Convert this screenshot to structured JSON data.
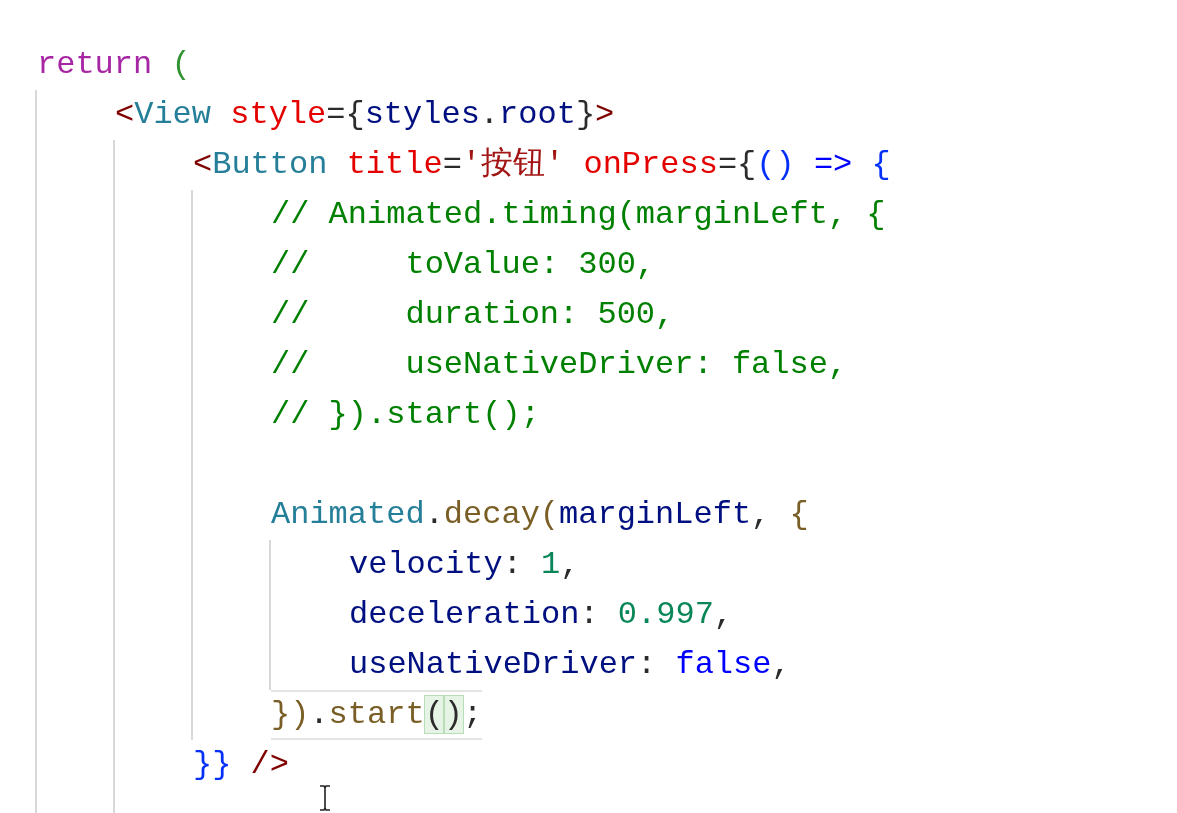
{
  "code_lines": [
    {
      "kind": "code",
      "current": false,
      "tokens": [
        {
          "text": "return ",
          "kind": "keyword"
        },
        {
          "text": "(",
          "kind": "bracket1"
        }
      ],
      "children": [
        {
          "kind": "code",
          "current": false,
          "tokens": [
            {
              "text": "<",
              "kind": "tag"
            },
            {
              "text": "View ",
              "kind": "type"
            },
            {
              "text": "style",
              "kind": "attr"
            },
            {
              "text": "=",
              "kind": "plain"
            },
            {
              "text": "{",
              "kind": "plain"
            },
            {
              "text": "styles",
              "kind": "var"
            },
            {
              "text": ".",
              "kind": "plain"
            },
            {
              "text": "root",
              "kind": "var"
            },
            {
              "text": "}",
              "kind": "plain"
            },
            {
              "text": ">",
              "kind": "tag"
            }
          ],
          "children": [
            {
              "kind": "code",
              "current": false,
              "tokens": [
                {
                  "text": "<",
                  "kind": "tag"
                },
                {
                  "text": "Button ",
                  "kind": "type"
                },
                {
                  "text": "title",
                  "kind": "attr"
                },
                {
                  "text": "=",
                  "kind": "plain"
                },
                {
                  "text": "'按钮' ",
                  "kind": "string"
                },
                {
                  "text": "onPress",
                  "kind": "attr"
                },
                {
                  "text": "=",
                  "kind": "plain"
                },
                {
                  "text": "{",
                  "kind": "plain"
                },
                {
                  "text": "() ",
                  "kind": "bracket3"
                },
                {
                  "text": "=> ",
                  "kind": "keyword2"
                },
                {
                  "text": "{",
                  "kind": "bracket3"
                }
              ],
              "children": [
                {
                  "kind": "code",
                  "current": false,
                  "tokens": [
                    {
                      "text": "// Animated.timing(marginLeft, {",
                      "kind": "comment"
                    }
                  ]
                },
                {
                  "kind": "code",
                  "current": false,
                  "tokens": [
                    {
                      "text": "//     toValue: 300,",
                      "kind": "comment"
                    }
                  ]
                },
                {
                  "kind": "code",
                  "current": false,
                  "tokens": [
                    {
                      "text": "//     duration: 500,",
                      "kind": "comment"
                    }
                  ]
                },
                {
                  "kind": "code",
                  "current": false,
                  "tokens": [
                    {
                      "text": "//     useNativeDriver: false,",
                      "kind": "comment"
                    }
                  ]
                },
                {
                  "kind": "code",
                  "current": false,
                  "tokens": [
                    {
                      "text": "// }).start();",
                      "kind": "comment"
                    }
                  ]
                },
                {
                  "kind": "blank",
                  "current": false
                },
                {
                  "kind": "code",
                  "current": false,
                  "tokens": [
                    {
                      "text": "Animated",
                      "kind": "type"
                    },
                    {
                      "text": ".",
                      "kind": "plain"
                    },
                    {
                      "text": "decay",
                      "kind": "func"
                    },
                    {
                      "text": "(",
                      "kind": "func"
                    },
                    {
                      "text": "marginLeft",
                      "kind": "var"
                    },
                    {
                      "text": ", ",
                      "kind": "plain"
                    },
                    {
                      "text": "{",
                      "kind": "func"
                    }
                  ],
                  "children": [
                    {
                      "kind": "code",
                      "current": false,
                      "tokens": [
                        {
                          "text": "velocity",
                          "kind": "var"
                        },
                        {
                          "text": ": ",
                          "kind": "plain"
                        },
                        {
                          "text": "1",
                          "kind": "num"
                        },
                        {
                          "text": ",",
                          "kind": "plain"
                        }
                      ]
                    },
                    {
                      "kind": "code",
                      "current": false,
                      "tokens": [
                        {
                          "text": "deceleration",
                          "kind": "var"
                        },
                        {
                          "text": ": ",
                          "kind": "plain"
                        },
                        {
                          "text": "0.997",
                          "kind": "num"
                        },
                        {
                          "text": ",",
                          "kind": "plain"
                        }
                      ]
                    },
                    {
                      "kind": "code",
                      "current": false,
                      "tokens": [
                        {
                          "text": "useNativeDriver",
                          "kind": "var"
                        },
                        {
                          "text": ": ",
                          "kind": "plain"
                        },
                        {
                          "text": "false",
                          "kind": "keyword2"
                        },
                        {
                          "text": ",",
                          "kind": "plain"
                        }
                      ]
                    }
                  ]
                },
                {
                  "kind": "code",
                  "current": true,
                  "tokens": [
                    {
                      "text": "})",
                      "kind": "func"
                    },
                    {
                      "text": ".",
                      "kind": "plain"
                    },
                    {
                      "text": "start",
                      "kind": "func"
                    },
                    {
                      "text": "(",
                      "kind": "match"
                    },
                    {
                      "text": ")",
                      "kind": "match"
                    },
                    {
                      "text": ";",
                      "kind": "plain"
                    }
                  ]
                }
              ]
            },
            {
              "kind": "code",
              "current": false,
              "tokens": [
                {
                  "text": "}} ",
                  "kind": "bracket3"
                },
                {
                  "text": "/>",
                  "kind": "tag"
                }
              ]
            },
            {
              "kind": "blank",
              "current": false
            }
          ]
        }
      ]
    }
  ]
}
